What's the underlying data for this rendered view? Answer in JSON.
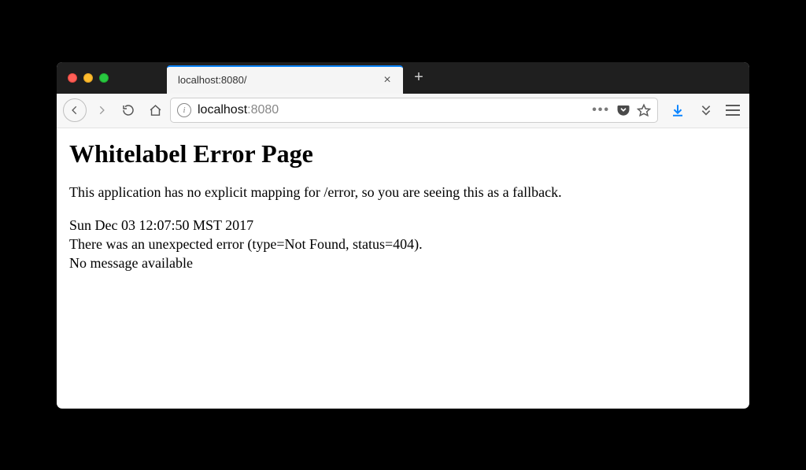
{
  "tab": {
    "title": "localhost:8080/"
  },
  "url": {
    "host": "localhost",
    "port": ":8080"
  },
  "page": {
    "heading": "Whitelabel Error Page",
    "fallback": "This application has no explicit mapping for /error, so you are seeing this as a fallback.",
    "timestamp": "Sun Dec 03 12:07:50 MST 2017",
    "error_line": "There was an unexpected error (type=Not Found, status=404).",
    "message": "No message available"
  }
}
